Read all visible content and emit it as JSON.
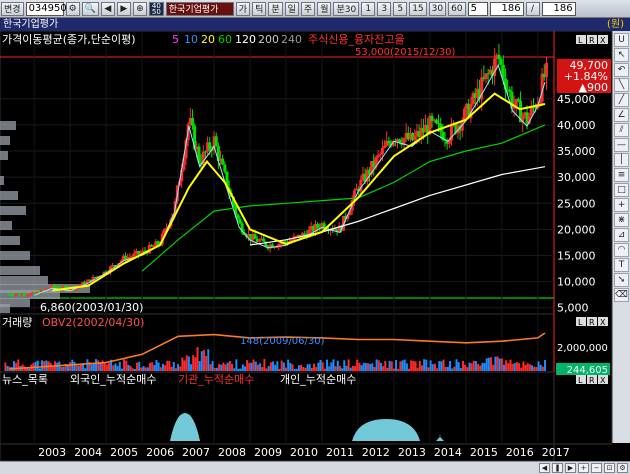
{
  "toolbar": {
    "menu_label": "변경",
    "code": "034950",
    "company_name": "한국기업평가",
    "icon_buttons": [
      "gear-icon",
      "search-icon",
      "prev-icon",
      "next-icon",
      "link-icon",
      "period-40-50"
    ],
    "type_buttons": [
      "가",
      "틱",
      "분",
      "일",
      "주",
      "월",
      "분30"
    ],
    "interval_buttons": [
      "1",
      "3",
      "5",
      "15",
      "30",
      "60"
    ],
    "interval_value": "5",
    "count_left": "186",
    "count_right": "186"
  },
  "titlebar": {
    "title": "한국기업평가",
    "unit": "(원)"
  },
  "price": {
    "current": "49,700",
    "change_pct": "+1.84%",
    "change": "▲900"
  },
  "overlays": {
    "ma_legend_prefix": "가격이동평균(종가,단순이평)",
    "ma_periods": [
      "5",
      "10",
      "20",
      "60",
      "120",
      "200",
      "240"
    ],
    "ma_colors": [
      "#ff3cff",
      "#3c8cff",
      "#ffff00",
      "#00d200",
      "#ffffff",
      "#bbbbbb",
      "#888888"
    ],
    "credit_label": "주식신용_융자잔고율",
    "high_label": "53,000(2015/12/30)",
    "low_label": "6,860(2003/01/30)",
    "volume_label": "거래량",
    "obv_label": "OBV2(2002/04/30)",
    "volume_mid_label": "148(2009/06/30)",
    "volume_axis_label": "2,000,000",
    "volume_value": "244,605",
    "flow_labels": [
      "뉴스_목록",
      "외국인_누적순매수",
      "기관_누적순매수",
      "개인_누적순매수"
    ],
    "panel_buttons": [
      "L",
      "R",
      "X"
    ]
  },
  "chart_data": {
    "type": "candlestick",
    "x_tick_labels": [
      "2003",
      "2004",
      "2005",
      "2006",
      "2007",
      "2008",
      "2009",
      "2010",
      "2011",
      "2012",
      "2013",
      "2014",
      "2015",
      "2016",
      "2017"
    ],
    "y_tick_labels": [
      "45,000",
      "40,000",
      "35,000",
      "30,000",
      "25,000",
      "20,000",
      "15,000",
      "10,000",
      "5,000"
    ],
    "ylim": [
      5000,
      55000
    ],
    "high": {
      "value": 53000,
      "date": "2015/12/30"
    },
    "low": {
      "value": 6860,
      "date": "2003/01/30"
    },
    "close_series": [
      {
        "year": 2003.0,
        "value": 7600
      },
      {
        "year": 2003.5,
        "value": 9000
      },
      {
        "year": 2004.0,
        "value": 8500
      },
      {
        "year": 2004.5,
        "value": 10000
      },
      {
        "year": 2005.0,
        "value": 12000
      },
      {
        "year": 2005.5,
        "value": 14500
      },
      {
        "year": 2006.0,
        "value": 15500
      },
      {
        "year": 2006.5,
        "value": 17500
      },
      {
        "year": 2006.9,
        "value": 24000
      },
      {
        "year": 2007.3,
        "value": 41000
      },
      {
        "year": 2007.6,
        "value": 33000
      },
      {
        "year": 2008.0,
        "value": 37000
      },
      {
        "year": 2008.3,
        "value": 30000
      },
      {
        "year": 2008.7,
        "value": 21000
      },
      {
        "year": 2009.0,
        "value": 18500
      },
      {
        "year": 2009.5,
        "value": 17000
      },
      {
        "year": 2010.0,
        "value": 17500
      },
      {
        "year": 2010.5,
        "value": 19000
      },
      {
        "year": 2011.0,
        "value": 21000
      },
      {
        "year": 2011.5,
        "value": 20000
      },
      {
        "year": 2012.0,
        "value": 28000
      },
      {
        "year": 2012.5,
        "value": 33000
      },
      {
        "year": 2013.0,
        "value": 38000
      },
      {
        "year": 2013.5,
        "value": 37000
      },
      {
        "year": 2014.0,
        "value": 40000
      },
      {
        "year": 2014.5,
        "value": 38000
      },
      {
        "year": 2015.0,
        "value": 42000
      },
      {
        "year": 2015.5,
        "value": 48000
      },
      {
        "year": 2015.9,
        "value": 53000
      },
      {
        "year": 2016.3,
        "value": 44000
      },
      {
        "year": 2016.7,
        "value": 41000
      },
      {
        "year": 2017.0,
        "value": 45000
      },
      {
        "year": 2017.2,
        "value": 49700
      }
    ],
    "ma_yellow": [
      {
        "year": 2003.5,
        "value": 8300
      },
      {
        "year": 2004.5,
        "value": 9200
      },
      {
        "year": 2005.5,
        "value": 13500
      },
      {
        "year": 2006.5,
        "value": 17000
      },
      {
        "year": 2007.3,
        "value": 28000
      },
      {
        "year": 2007.8,
        "value": 33000
      },
      {
        "year": 2008.3,
        "value": 29000
      },
      {
        "year": 2009.0,
        "value": 20000
      },
      {
        "year": 2010.0,
        "value": 17200
      },
      {
        "year": 2011.0,
        "value": 19500
      },
      {
        "year": 2012.0,
        "value": 26000
      },
      {
        "year": 2013.0,
        "value": 34000
      },
      {
        "year": 2014.0,
        "value": 38500
      },
      {
        "year": 2015.0,
        "value": 41000
      },
      {
        "year": 2015.8,
        "value": 46000
      },
      {
        "year": 2016.5,
        "value": 43000
      },
      {
        "year": 2017.2,
        "value": 44000
      }
    ],
    "ma_green": [
      {
        "year": 2006.0,
        "value": 12000
      },
      {
        "year": 2007.0,
        "value": 18000
      },
      {
        "year": 2008.0,
        "value": 23500
      },
      {
        "year": 2009.0,
        "value": 24500
      },
      {
        "year": 2010.0,
        "value": 25000
      },
      {
        "year": 2011.0,
        "value": 25500
      },
      {
        "year": 2012.0,
        "value": 26000
      },
      {
        "year": 2013.0,
        "value": 29000
      },
      {
        "year": 2014.0,
        "value": 33000
      },
      {
        "year": 2015.0,
        "value": 35000
      },
      {
        "year": 2016.0,
        "value": 36500
      },
      {
        "year": 2017.2,
        "value": 40000
      }
    ],
    "ma_white": [
      {
        "year": 2009.0,
        "value": 17000
      },
      {
        "year": 2010.0,
        "value": 18000
      },
      {
        "year": 2011.0,
        "value": 19500
      },
      {
        "year": 2012.0,
        "value": 21500
      },
      {
        "year": 2013.0,
        "value": 24000
      },
      {
        "year": 2014.0,
        "value": 26500
      },
      {
        "year": 2015.0,
        "value": 28500
      },
      {
        "year": 2016.0,
        "value": 30500
      },
      {
        "year": 2017.2,
        "value": 32000
      }
    ],
    "obv": [
      {
        "year": 2002.3,
        "value": 0
      },
      {
        "year": 2004.0,
        "value": 250000
      },
      {
        "year": 2005.0,
        "value": 400000
      },
      {
        "year": 2006.0,
        "value": 900000
      },
      {
        "year": 2007.0,
        "value": 2000000
      },
      {
        "year": 2008.0,
        "value": 2100000
      },
      {
        "year": 2009.0,
        "value": 1900000
      },
      {
        "year": 2010.0,
        "value": 1950000
      },
      {
        "year": 2011.0,
        "value": 1900000
      },
      {
        "year": 2012.0,
        "value": 1800000
      },
      {
        "year": 2013.0,
        "value": 1800000
      },
      {
        "year": 2014.0,
        "value": 1700000
      },
      {
        "year": 2015.0,
        "value": 1600000
      },
      {
        "year": 2016.0,
        "value": 1700000
      },
      {
        "year": 2017.0,
        "value": 1900000
      },
      {
        "year": 2017.2,
        "value": 2200000
      }
    ]
  }
}
